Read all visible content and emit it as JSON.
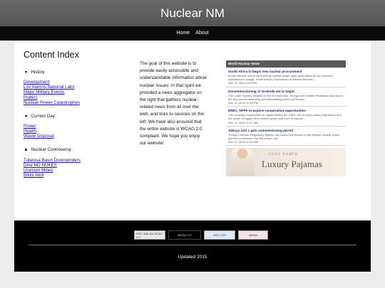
{
  "site_title": "Nuclear NM",
  "nav": [
    {
      "label": "Home"
    },
    {
      "label": "About"
    }
  ],
  "content_index": {
    "title": "Content Index",
    "sections": [
      {
        "heading": "History",
        "links": [
          "Development",
          "Los Alamos National Labs",
          "Major Military Events",
          "Politics",
          "Nuclear Power Catastrophes"
        ]
      },
      {
        "heading": "Current Day",
        "links": [
          "Power",
          "Health",
          "Waste Disposal"
        ]
      },
      {
        "heading": "Nuclear Controversy",
        "links": [
          "Tularosa Basin Downwinders",
          "Dine NO NUKES",
          "Uranium Mines",
          "Bikini Atoll"
        ]
      }
    ]
  },
  "intro_text": "The goal of this website is to provide easily accessible and understandable information about nuclear issues. In that spirit we provided a news aggregator on the right that gathers nuclear-related news from all over the web, and links to sources on the left. We have also ensured that the entire website is WCAG 2.0 compliant. We hope you enjoy our website!",
  "news": {
    "header": "World Nuclear News",
    "items": [
      {
        "title": "South Africa to begin new nuclear procurement",
        "desc": "As the second unit at the Koeberg nuclear power plant goes offline for an extended maintenance outage, South Africa's Department of Mineral Resourc...",
        "date": "Dec 12, 2023 3:49 PM"
      },
      {
        "title": "Decommissioning of Grohnde set to begin",
        "desc": "The Lower Saxony Ministry for the Environment, Energy and Climate Protection has issued the first decommissioning and dismantling permit to Preusse...",
        "date": "Dec 12, 2023 12:54 PM"
      },
      {
        "title": "ENEC, NPPA to explore cooperation opportunities",
        "desc": "The company responsible for implementing the UAE's civil nuclear power programme and the owner of Egypt's first nuclear power plant are to explore...",
        "date": "Dec 12, 2023 11:47 AM"
      },
      {
        "title": "Akkuyu unit 1 gets commissioning permit",
        "desc": "Turkey's Nuclear Regulatory Agency has issued permission to the Akkuyu nuclear power plant to commission the first power unit.",
        "date": "Dec 12, 2023 11:46 AM"
      }
    ],
    "ad": {
      "brand": "COZY EARTH",
      "title": "Luxury Pajamas"
    }
  },
  "footer": {
    "badges": [
      {
        "icon": "w3c-wai-aa-icon",
        "label": "W3C WAI-AA WCAG 2.0"
      },
      {
        "icon": "wcag-icon",
        "label": "WCAG 2.0"
      },
      {
        "icon": "w3c-css-icon",
        "label": "W3C CSS"
      },
      {
        "icon": "debian-icon",
        "label": "debian"
      }
    ],
    "updated": "Updated 2015"
  }
}
